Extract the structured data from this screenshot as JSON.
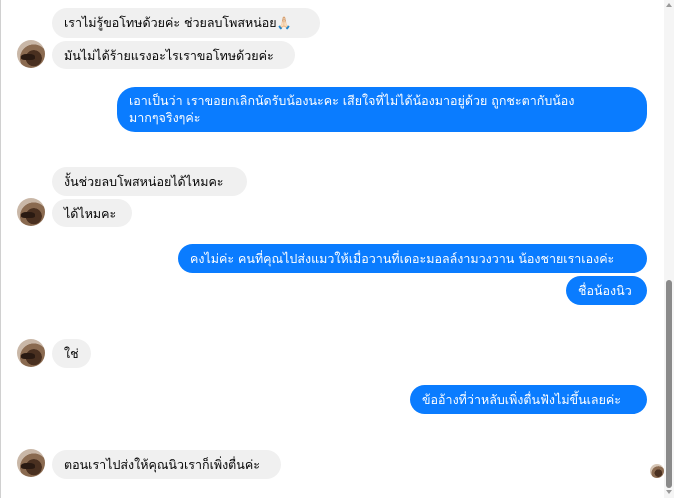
{
  "messages": [
    {
      "id": "m1",
      "side": "in",
      "text": "เราไม่รู้ขอโทษด้วยค่ะ ช่วยลบโพสหน่อย",
      "emoji": "🙏🏻"
    },
    {
      "id": "m2",
      "side": "in",
      "text": "มันไม่ได้ร้ายแรงอะไรเราขอโทษด้วยค่ะ"
    },
    {
      "id": "m3",
      "side": "out",
      "line1": "เอาเป็นว่า เราขอยกเลิกนัดรับน้องนะคะ เสียใจที่ไม่ได้น้องมาอยู่ด้วย ถูกชะตากับน้อง",
      "line2": "มากๆจริงๆค่ะ"
    },
    {
      "id": "m4",
      "side": "in",
      "text": "งั้นช่วยลบโพสหน่อยได้ไหมคะ"
    },
    {
      "id": "m5",
      "side": "in",
      "text": "ได้ไหมคะ"
    },
    {
      "id": "m6",
      "side": "out",
      "text": "คงไม่ค่ะ คนที่คุณไปส่งแมวให้เมื่อวานที่เดอะมอลล์งามวงวาน น้องชายเราเองค่ะ"
    },
    {
      "id": "m7",
      "side": "out",
      "text": "ชื่อน้องนิว"
    },
    {
      "id": "m8",
      "side": "in",
      "text": "ใช่"
    },
    {
      "id": "m9",
      "side": "out",
      "text": "ข้ออ้างที่ว่าหลับเพิ่งตื่นฟังไม่ขึ้นเลยค่ะ"
    },
    {
      "id": "m10",
      "side": "in",
      "text": "ตอนเราไปส่งให้คุณนิวเราก็เพิ่งตื่นค่ะ"
    }
  ],
  "colors": {
    "outgoing": "#0a7cff",
    "incoming": "#f0f0f0"
  },
  "icons": {
    "seen": "contact-avatar-seen-icon",
    "avatar": "contact-avatar-icon"
  }
}
